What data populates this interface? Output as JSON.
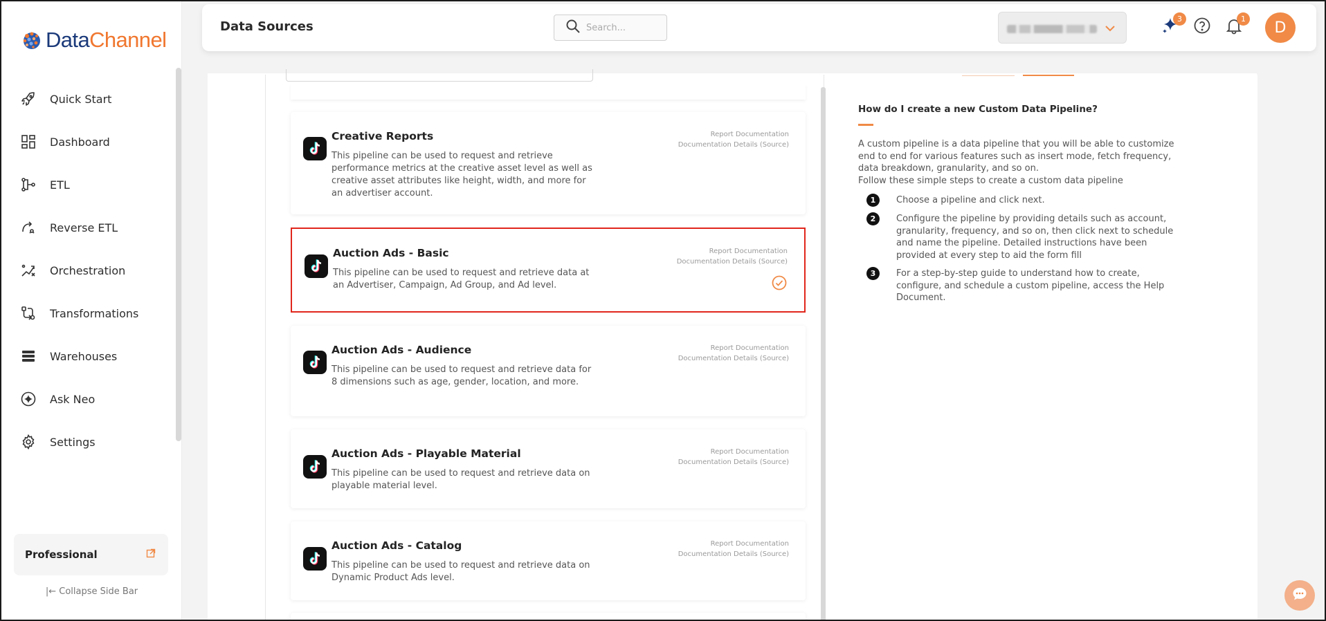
{
  "app": {
    "brand_part1": "Data",
    "brand_part2": "Channel"
  },
  "sidebar": {
    "items": [
      {
        "label": "Quick Start",
        "icon": "rocket-icon"
      },
      {
        "label": "Dashboard",
        "icon": "dashboard-icon"
      },
      {
        "label": "ETL",
        "icon": "etl-icon"
      },
      {
        "label": "Reverse ETL",
        "icon": "reverse-etl-icon"
      },
      {
        "label": "Orchestration",
        "icon": "orchestration-icon"
      },
      {
        "label": "Transformations",
        "icon": "transformations-icon"
      },
      {
        "label": "Warehouses",
        "icon": "warehouses-icon"
      },
      {
        "label": "Ask Neo",
        "icon": "ask-neo-icon"
      },
      {
        "label": "Settings",
        "icon": "settings-icon"
      }
    ],
    "plan_label": "Professional",
    "collapse_label": "Collapse Side Bar"
  },
  "header": {
    "title": "Data Sources",
    "search_placeholder": "Search...",
    "neo_badge": "3",
    "notif_badge": "1",
    "avatar_initial": "D"
  },
  "pipelines": [
    {
      "title": "Creative Reports",
      "desc": "This pipeline can be used to request and retrieve performance metrics at the creative asset level as well as creative asset attributes like height, width, and more for an advertiser account.",
      "link1": "Report Documentation",
      "link2": "Documentation Details (Source)",
      "selected": false
    },
    {
      "title": "Auction Ads - Basic",
      "desc": "This pipeline can be used to request and retrieve data at an Advertiser, Campaign, Ad Group, and Ad level.",
      "link1": "Report Documentation",
      "link2": "Documentation Details (Source)",
      "selected": true
    },
    {
      "title": "Auction Ads - Audience",
      "desc": "This pipeline can be used to request and retrieve data for 8 dimensions such as age, gender, location, and more.",
      "link1": "Report Documentation",
      "link2": "Documentation Details (Source)",
      "selected": false
    },
    {
      "title": "Auction Ads - Playable Material",
      "desc": "This pipeline can be used to request and retrieve data on playable material level.",
      "link1": "Report Documentation",
      "link2": "Documentation Details (Source)",
      "selected": false
    },
    {
      "title": "Auction Ads - Catalog",
      "desc": "This pipeline can be used to request and retrieve data on Dynamic Product Ads level.",
      "link1": "Report Documentation",
      "link2": "Documentation Details (Source)",
      "selected": false
    }
  ],
  "help": {
    "title": "How do I create a new Custom Data Pipeline?",
    "intro": "A custom pipeline is a data pipeline that you will be able to customize end to end for various features such as insert mode, fetch frequency, data breakdown, granularity, and so on.",
    "intro2": "Follow these simple steps to create a custom data pipeline",
    "steps": [
      {
        "num": "1",
        "text": "Choose a pipeline and click next."
      },
      {
        "num": "2",
        "text": "Configure the pipeline by providing details such as account, granularity, frequency, and so on, then click next to schedule and name the pipeline. Detailed instructions have been provided at every step to aid the form fill"
      },
      {
        "num": "3",
        "text": "For a step-by-step guide to understand how to create, configure, and schedule a custom pipeline, access the Help Document."
      }
    ]
  },
  "colors": {
    "accent": "#f08a46",
    "brand_blue": "#1b3a7a",
    "brand_orange": "#f0772f",
    "selected_border": "#e0251b"
  }
}
